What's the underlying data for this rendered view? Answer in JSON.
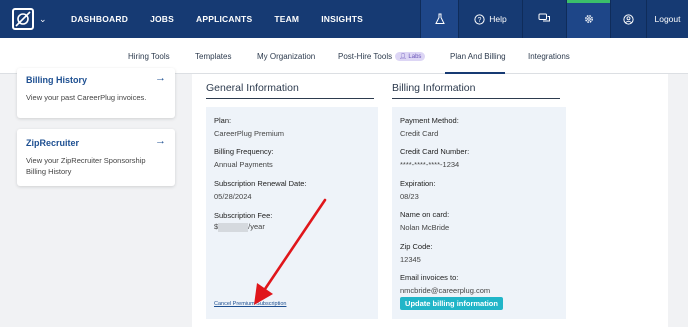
{
  "topnav": {
    "items": [
      "DASHBOARD",
      "JOBS",
      "APPLICANTS",
      "TEAM",
      "INSIGHTS"
    ],
    "help_label": "Help",
    "logout_label": "Logout",
    "icons": [
      "logo-icon",
      "flask-icon",
      "help-icon",
      "chat-icon",
      "gear-icon",
      "user-icon"
    ],
    "active_indicator_color": "#3bc06a",
    "nav_bg_color": "#163a73"
  },
  "subnav": {
    "items": [
      "Hiring Tools",
      "Templates",
      "My Organization",
      "Post-Hire Tools",
      "Plan And Billing",
      "Integrations"
    ],
    "labs_badge": "Labs",
    "active": "Plan And Billing"
  },
  "sidebar": {
    "cards": [
      {
        "title": "Billing History",
        "desc_lines": [
          "View your past CareerPlug invoices."
        ]
      },
      {
        "title": "ZipRecruiter",
        "desc_lines": [
          "View your ZipRecruiter Sponsorship",
          "Billing History"
        ]
      }
    ]
  },
  "general": {
    "title": "General Information",
    "plan_label": "Plan:",
    "plan_value": "CareerPlug Premium",
    "freq_label": "Billing Frequency:",
    "freq_value": "Annual Payments",
    "renewal_label": "Subscription Renewal Date:",
    "renewal_value": "05/28/2024",
    "fee_label": "Subscription Fee:",
    "fee_prefix": "$",
    "fee_suffix": "/year",
    "cancel_link": "Cancel Premium Subscription"
  },
  "billing": {
    "title": "Billing Information",
    "method_label": "Payment Method:",
    "method_value": "Credit Card",
    "card_label": "Credit Card Number:",
    "card_value": "****-****-****-1234",
    "exp_label": "Expiration:",
    "exp_value": "08/23",
    "name_label": "Name on card:",
    "name_value": "Nolan McBride",
    "zip_label": "Zip Code:",
    "zip_value": "12345",
    "email_label": "Email invoices to:",
    "email_value": "nmcbride@careerplug.com",
    "update_button": "Update billing information"
  },
  "annotation": {
    "arrow_color": "#e0161b"
  }
}
